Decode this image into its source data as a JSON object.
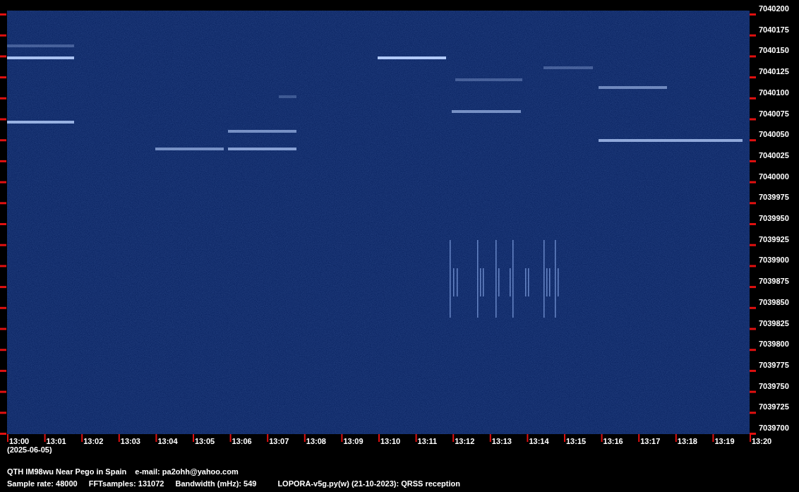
{
  "spectrogram": {
    "frequency_labels": [
      "7040200",
      "7040175",
      "7040150",
      "7040125",
      "7040100",
      "7040075",
      "7040050",
      "7040025",
      "7040000",
      "7039975",
      "7039950",
      "7039925",
      "7039900",
      "7039875",
      "7039850",
      "7039825",
      "7039800",
      "7039775",
      "7039750",
      "7039725",
      "7039700"
    ],
    "time_labels": [
      "13:00",
      "13:01",
      "13:02",
      "13:03",
      "13:04",
      "13:05",
      "13:06",
      "13:07",
      "13:08",
      "13:09",
      "13:10",
      "13:11",
      "13:12",
      "13:13",
      "13:14",
      "13:15",
      "13:16",
      "13:17",
      "13:18",
      "13:19",
      "13:20"
    ],
    "date": "(2025-06-05)"
  },
  "footer": [
    {
      "items": [
        "QTH IM98wu Near Pego in Spain",
        "e-mail: pa2ohh@yahoo.com"
      ]
    },
    {
      "items": [
        "Sample rate: 48000",
        "FFTsamples: 131072",
        "Bandwidth (mHz): 549",
        "LOPORA-v5g.py(w) (21-10-2023): QRSS reception"
      ]
    }
  ]
}
